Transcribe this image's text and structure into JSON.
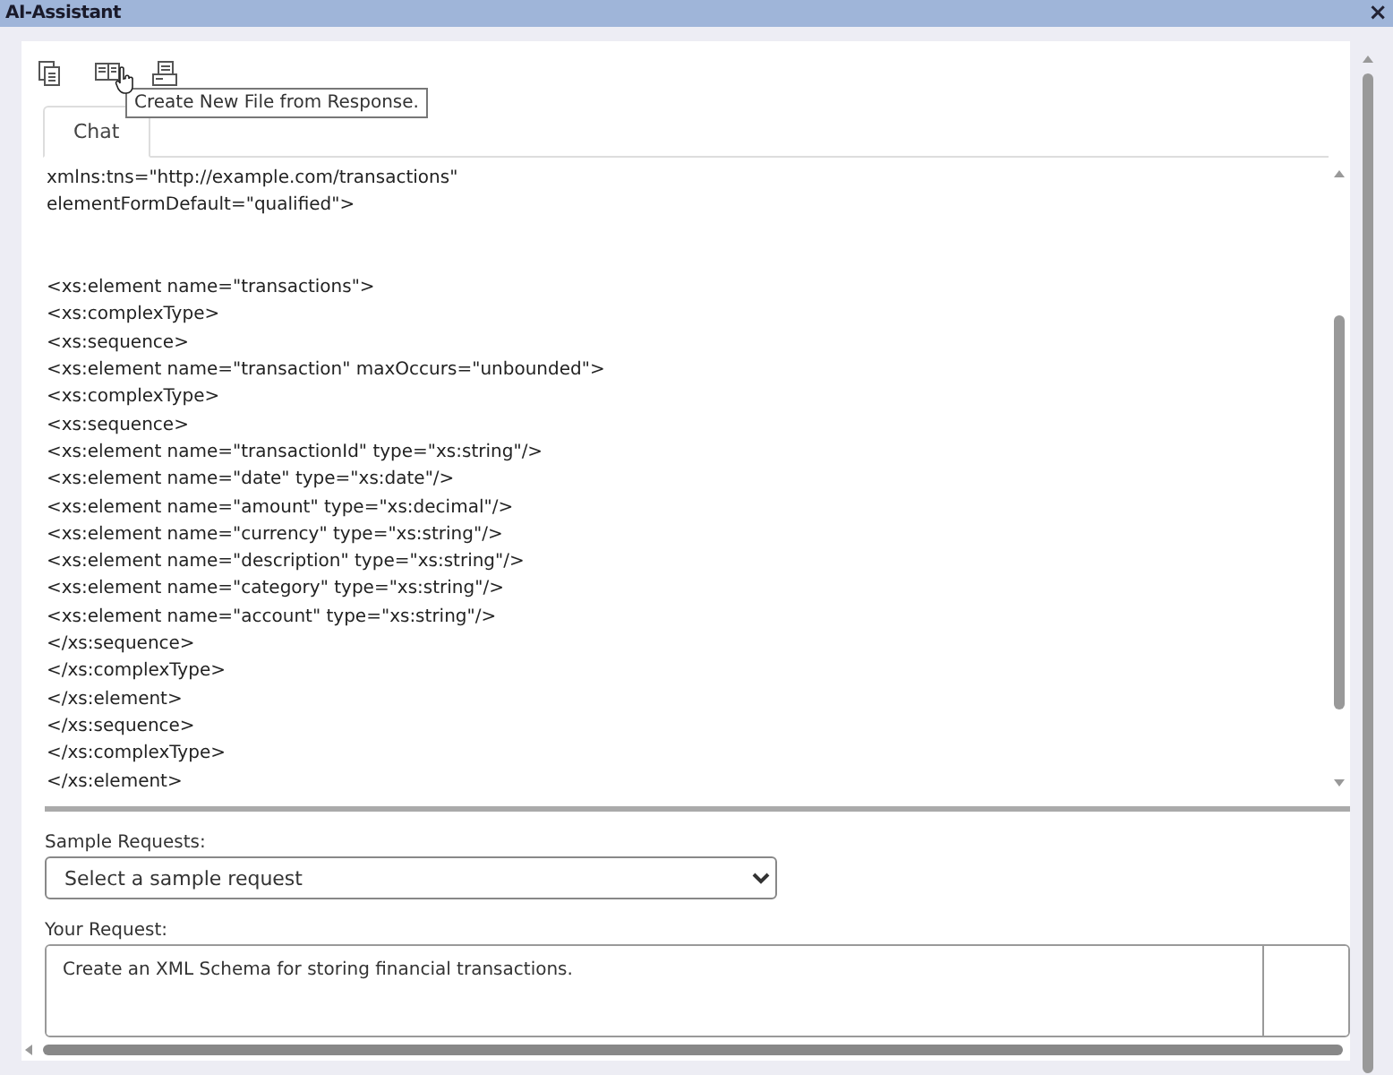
{
  "window": {
    "title": "AI-Assistant",
    "close": "×"
  },
  "toolbar": {
    "tooltip": "Create New File from Response."
  },
  "tabs": [
    {
      "label": "Chat",
      "selected": true
    }
  ],
  "response": {
    "preamble": [
      "xmlns:tns=\"http://example.com/transactions\"",
      "elementFormDefault=\"qualified\">"
    ],
    "lines": [
      "<xs:element name=\"transactions\">",
      "<xs:complexType>",
      "<xs:sequence>",
      "<xs:element name=\"transaction\" maxOccurs=\"unbounded\">",
      "<xs:complexType>",
      "<xs:sequence>",
      "<xs:element name=\"transactionId\" type=\"xs:string\"/>",
      "<xs:element name=\"date\" type=\"xs:date\"/>",
      "<xs:element name=\"amount\" type=\"xs:decimal\"/>",
      "<xs:element name=\"currency\" type=\"xs:string\"/>",
      "<xs:element name=\"description\" type=\"xs:string\"/>",
      "<xs:element name=\"category\" type=\"xs:string\"/>",
      "<xs:element name=\"account\" type=\"xs:string\"/>",
      "</xs:sequence>",
      "</xs:complexType>",
      "</xs:element>",
      "</xs:sequence>",
      "</xs:complexType>",
      "</xs:element>"
    ]
  },
  "sample_requests": {
    "label": "Sample Requests:",
    "placeholder": "Select a sample request"
  },
  "your_request": {
    "label": "Your Request:",
    "value": "Create an XML Schema for storing financial transactions."
  }
}
